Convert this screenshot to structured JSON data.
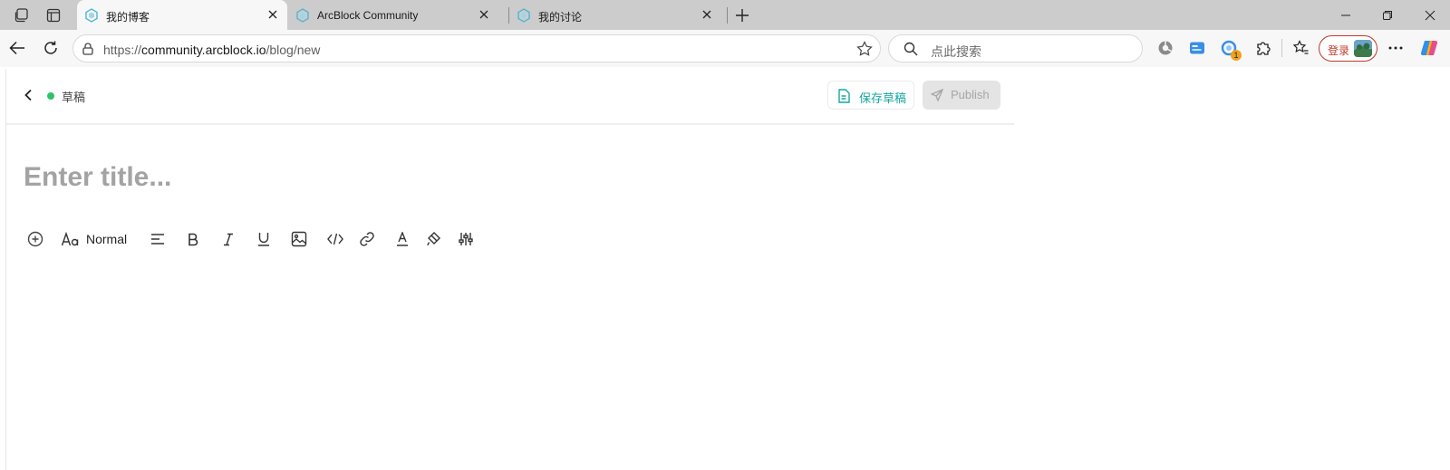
{
  "browser": {
    "tabs": [
      {
        "title": "我的博客",
        "active": true
      },
      {
        "title": "ArcBlock Community",
        "active": false
      },
      {
        "title": "我的讨论",
        "active": false
      }
    ],
    "address": {
      "scheme": "https://",
      "host": "community.arcblock.io",
      "path": "/blog/new"
    },
    "search_placeholder": "点此搜索",
    "login_label": "登录",
    "extension_badge_count": "1",
    "icons": {
      "workspaces": "workspaces-icon",
      "vertical_tabs": "vertical-tabs-icon",
      "back": "back-arrow-icon",
      "reload": "reload-icon",
      "site_info": "site-info-icon",
      "favorite": "star-icon",
      "search": "search-icon",
      "collections": "favorites-icon",
      "more": "more-icon",
      "copilot": "copilot-icon"
    }
  },
  "editor": {
    "status_label": "草稿",
    "save_draft_label": "保存草稿",
    "publish_label": "Publish",
    "title_placeholder": "Enter title...",
    "format_value": "Normal",
    "toolbar_icons": [
      "insert-plus-icon",
      "text-style-icon",
      "align-left-icon",
      "bold-icon",
      "italic-icon",
      "underline-icon",
      "image-icon",
      "code-icon",
      "link-icon",
      "text-color-icon",
      "highlight-icon",
      "settings-sliders-icon"
    ]
  },
  "colors": {
    "accent": "#16a7a0",
    "status_green": "#2cc36b",
    "login_red": "#c0392b"
  }
}
